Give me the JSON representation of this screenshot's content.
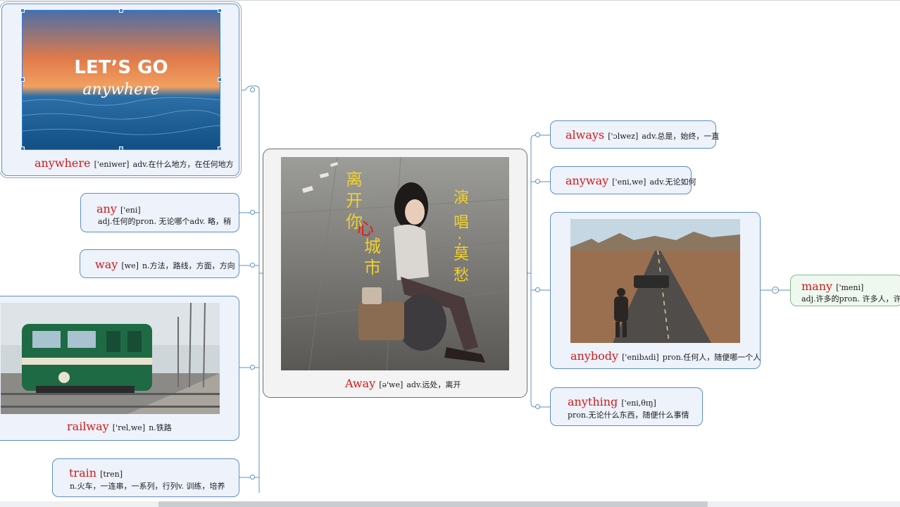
{
  "center": {
    "word": "Away",
    "phonetic": "[ə'we]",
    "definition": "adv.远处，离开",
    "poster_title": "离开你心城市",
    "poster_singer": "演唱：莫愁"
  },
  "left_nodes": {
    "anywhere": {
      "word": "anywhere",
      "phonetic": "['eniwer]",
      "definition": "adv.在什么地方，在任何地方",
      "image_text_1": "LET’S GO",
      "image_text_2": "anywhere"
    },
    "any": {
      "word": "any",
      "phonetic": "['eni]",
      "definition": "adj.任何的pron. 无论哪个adv. 略，稍"
    },
    "way": {
      "word": "way",
      "phonetic": "[we]",
      "definition": "n.方法，路线，方面，方向"
    },
    "railway": {
      "word": "railway",
      "phonetic": "['rel,we]",
      "definition": "n.铁路"
    },
    "train": {
      "word": "train",
      "phonetic": "[tren]",
      "definition": "n.火车，一连串，一系列，行列v. 训练，培养"
    }
  },
  "right_nodes": {
    "always": {
      "word": "always",
      "phonetic": "['ɔlwez]",
      "definition": "adv.总是，始终，一直"
    },
    "anyway": {
      "word": "anyway",
      "phonetic": "['eni,we]",
      "definition": "adv.无论如何"
    },
    "anybody": {
      "word": "anybody",
      "phonetic": "['enibʌdi]",
      "definition": "pron.任何人，随便哪一个人"
    },
    "anything": {
      "word": "anything",
      "phonetic": "['eni,θɪŋ]",
      "definition": "pron.无论什么东西，随便什么事情"
    },
    "many": {
      "word": "many",
      "phonetic": "['meni]",
      "definition": "adj.许多的pron. 许多人，许多"
    }
  },
  "colors": {
    "word": "#d21a1a",
    "node_border": "#5f8fc4",
    "node_fill": "#edf2fb",
    "center_border": "#6f6f6f",
    "many_border": "#86b98c",
    "selection": "#2f7fe0"
  },
  "icons": [
    "collapse-toggle-icon",
    "connector-dot-icon"
  ]
}
